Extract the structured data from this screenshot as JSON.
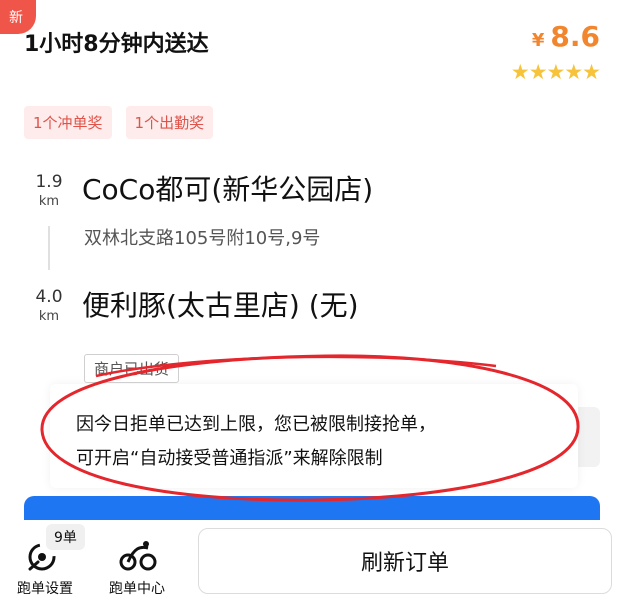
{
  "order": {
    "badge": "新",
    "delivery_time": "1小时8分钟内送达",
    "currency": "¥",
    "price": "8.6",
    "rating": 4.5,
    "rating_max": 5,
    "tags": [
      "1个冲单奖",
      "1个出勤奖"
    ],
    "pickup": {
      "distance": "1.9",
      "unit": "km",
      "name": "CoCo都可(新华公园店)",
      "address": "双林北支路105号附10号,9号"
    },
    "dropoff": {
      "distance": "4.0",
      "unit": "km",
      "name": "便利豚(太古里店) (无)"
    },
    "status": "商户已出货"
  },
  "toast": {
    "line1": "因今日拒单已达到上限，您已被限制接抢单，",
    "line2": "可开启“自动接受普通指派”来解除限制"
  },
  "colors": {
    "price": "#f2862e",
    "tag_bg": "#fdeceb",
    "tag_text": "#e0534a",
    "badge": "#f0554a",
    "primary_button": "#1f76f2",
    "annotation_circle": "#e4262d",
    "star": "#f6c33a"
  },
  "bottom_bar": {
    "settings_label": "跑单设置",
    "settings_icon": "dispatch-settings-icon",
    "count": "9单",
    "center_label": "跑单中心",
    "center_icon": "courier-center-icon",
    "refresh_label": "刷新订单"
  }
}
